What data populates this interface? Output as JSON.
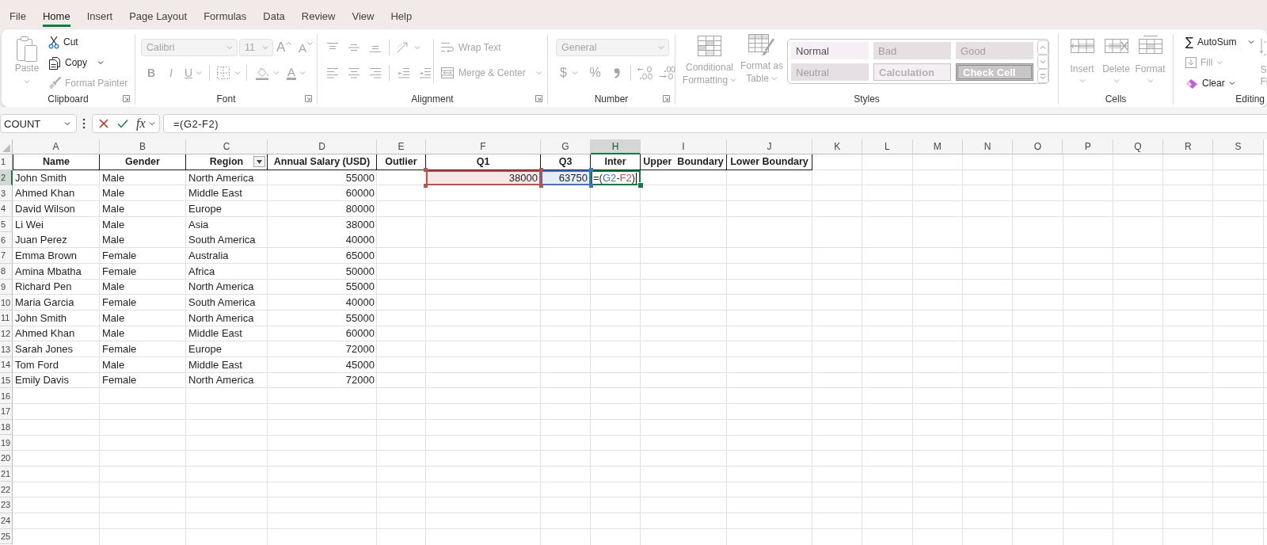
{
  "menu_tabs": [
    {
      "label": "File",
      "selected": false
    },
    {
      "label": "Home",
      "selected": true
    },
    {
      "label": "Insert",
      "selected": false
    },
    {
      "label": "Page Layout",
      "selected": false
    },
    {
      "label": "Formulas",
      "selected": false
    },
    {
      "label": "Data",
      "selected": false
    },
    {
      "label": "Review",
      "selected": false
    },
    {
      "label": "View",
      "selected": false
    },
    {
      "label": "Help",
      "selected": false
    }
  ],
  "ribbon": {
    "clipboard": {
      "label": "Clipboard",
      "paste": {
        "label": "Paste",
        "disabled": true
      },
      "cut": {
        "label": "Cut",
        "disabled": false
      },
      "copy": {
        "label": "Copy",
        "disabled": false
      },
      "format_painter": {
        "label": "Format Painter",
        "disabled": true
      }
    },
    "font": {
      "label": "Font",
      "disabled": true,
      "font_name": "Calibri",
      "font_size": "11",
      "grow_font": "A",
      "shrink_font": "A",
      "bold": "B",
      "italic": "I",
      "underline": "U",
      "font_color": "A"
    },
    "alignment": {
      "label": "Alignment",
      "disabled": true,
      "wrap_text": "Wrap Text",
      "merge_center": "Merge & Center"
    },
    "number": {
      "label": "Number",
      "disabled": true,
      "format": "General",
      "currency": "$",
      "percent": "%"
    },
    "styles": {
      "label": "Styles",
      "disabled": true,
      "conditional_formatting": [
        "Conditional",
        "Formatting"
      ],
      "format_as_table": [
        "Format as",
        "Table"
      ],
      "gallery": [
        {
          "label": "Normal",
          "kind": "normal"
        },
        {
          "label": "Bad",
          "kind": "bad"
        },
        {
          "label": "Good",
          "kind": "good"
        },
        {
          "label": "Neutral",
          "kind": "neutral"
        },
        {
          "label": "Calculation",
          "kind": "calculation"
        },
        {
          "label": "Check Cell",
          "kind": "check"
        }
      ]
    },
    "cells": {
      "label": "Cells",
      "disabled": true,
      "buttons": [
        {
          "label": "Insert",
          "kind": "insert"
        },
        {
          "label": "Delete",
          "kind": "delete"
        },
        {
          "label": "Format",
          "kind": "format"
        }
      ]
    },
    "editing": {
      "label": "Editing",
      "autosum": {
        "symbol": "∑",
        "label": "AutoSum",
        "disabled": false
      },
      "fill": {
        "label": "Fill",
        "disabled": true
      },
      "clear": {
        "label": "Clear",
        "disabled": false
      },
      "sort_filter": {
        "lines": [
          "S",
          "Fi"
        ],
        "disabled": true
      }
    }
  },
  "formula_bar": {
    "name_box": "COUNT",
    "function_label": "fx",
    "formula": "=(G2-F2)"
  },
  "sheet": {
    "columns": [
      {
        "label": "A",
        "selected": false
      },
      {
        "label": "B",
        "selected": false
      },
      {
        "label": "C",
        "selected": false
      },
      {
        "label": "D",
        "selected": false
      },
      {
        "label": "E",
        "selected": false
      },
      {
        "label": "F",
        "selected": false
      },
      {
        "label": "G",
        "selected": false
      },
      {
        "label": "H",
        "selected": true
      },
      {
        "label": "I",
        "selected": false
      },
      {
        "label": "J",
        "selected": false
      },
      {
        "label": "K",
        "selected": false
      },
      {
        "label": "L",
        "selected": false
      },
      {
        "label": "M",
        "selected": false
      },
      {
        "label": "N",
        "selected": false
      },
      {
        "label": "O",
        "selected": false
      },
      {
        "label": "P",
        "selected": false
      },
      {
        "label": "Q",
        "selected": false
      },
      {
        "label": "R",
        "selected": false
      },
      {
        "label": "S",
        "selected": false
      }
    ],
    "row_headers": [
      {
        "label": "1",
        "selected": false
      },
      {
        "label": "2",
        "selected": true
      },
      {
        "label": "3",
        "selected": false
      },
      {
        "label": "4",
        "selected": false
      },
      {
        "label": "5",
        "selected": false
      },
      {
        "label": "6",
        "selected": false
      },
      {
        "label": "7",
        "selected": false
      },
      {
        "label": "8",
        "selected": false
      },
      {
        "label": "9",
        "selected": false
      },
      {
        "label": "10",
        "selected": false
      },
      {
        "label": "11",
        "selected": false
      },
      {
        "label": "12",
        "selected": false
      },
      {
        "label": "13",
        "selected": false
      },
      {
        "label": "14",
        "selected": false
      },
      {
        "label": "15",
        "selected": false
      },
      {
        "label": "16",
        "selected": false
      },
      {
        "label": "17",
        "selected": false
      },
      {
        "label": "18",
        "selected": false
      },
      {
        "label": "19",
        "selected": false
      },
      {
        "label": "20",
        "selected": false
      },
      {
        "label": "21",
        "selected": false
      },
      {
        "label": "22",
        "selected": false
      },
      {
        "label": "23",
        "selected": false
      },
      {
        "label": "24",
        "selected": false
      },
      {
        "label": "25",
        "selected": false
      }
    ],
    "header_row": [
      {
        "text": "Name",
        "filter": false
      },
      {
        "text": "Gender",
        "filter": false
      },
      {
        "text": "Region",
        "filter": true
      },
      {
        "text": "Annual Salary (USD)",
        "filter": false
      },
      {
        "text": "Outlier",
        "filter": false
      },
      {
        "text": "Q1",
        "filter": false
      },
      {
        "text": "Q3",
        "filter": false
      },
      {
        "text": "Inter",
        "filter": false
      },
      {
        "text": "Upper  Boundary",
        "filter": false
      },
      {
        "text": "Lower Boundary",
        "filter": false
      }
    ],
    "records": [
      {
        "name": "John Smith",
        "gender": "Male",
        "region": "North America",
        "salary": "55000"
      },
      {
        "name": "Ahmed Khan",
        "gender": "Male",
        "region": "Middle East",
        "salary": "60000"
      },
      {
        "name": "David Wilson",
        "gender": "Male",
        "region": "Europe",
        "salary": "80000"
      },
      {
        "name": "Li Wei",
        "gender": "Male",
        "region": "Asia",
        "salary": "38000"
      },
      {
        "name": "Juan Perez",
        "gender": "Male",
        "region": "South America",
        "salary": "40000"
      },
      {
        "name": "Emma Brown",
        "gender": "Female",
        "region": "Australia",
        "salary": "65000"
      },
      {
        "name": "Amina Mbatha",
        "gender": "Female",
        "region": "Africa",
        "salary": "50000"
      },
      {
        "name": "Richard Pen",
        "gender": "Male",
        "region": "North America",
        "salary": "55000"
      },
      {
        "name": "Maria Garcia",
        "gender": "Female",
        "region": "South America",
        "salary": "40000"
      },
      {
        "name": "John Smith",
        "gender": "Male",
        "region": "North America",
        "salary": "55000"
      },
      {
        "name": "Ahmed Khan",
        "gender": "Male",
        "region": "Middle East",
        "salary": "60000"
      },
      {
        "name": "Sarah Jones",
        "gender": "Female",
        "region": "Europe",
        "salary": "72000"
      },
      {
        "name": "Tom Ford",
        "gender": "Male",
        "region": "Middle East",
        "salary": "45000"
      },
      {
        "name": "Emily Davis",
        "gender": "Female",
        "region": "North America",
        "salary": "72000"
      }
    ],
    "q1": {
      "value": "38000",
      "color": "#c0504d"
    },
    "q3": {
      "value": "63750",
      "color": "#4472c4"
    },
    "inter": {
      "editing": true,
      "formula": [
        {
          "text": "=("
        },
        {
          "text": "G2",
          "color": "#4472c4"
        },
        {
          "text": "-"
        },
        {
          "text": "F2",
          "color": "#c0504d"
        },
        {
          "text": ")"
        }
      ]
    }
  }
}
